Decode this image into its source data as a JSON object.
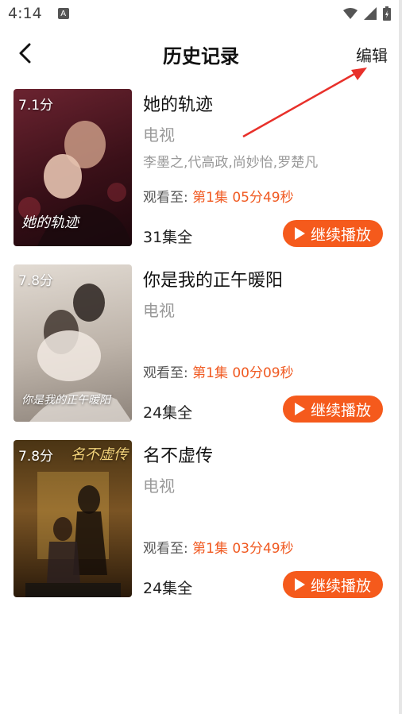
{
  "status_bar": {
    "time": "4:14",
    "app_badge": "A"
  },
  "header": {
    "title": "历史记录",
    "edit_label": "编辑"
  },
  "items": [
    {
      "score": "7.1分",
      "poster_title": "她的轨迹",
      "name": "她的轨迹",
      "type": "电视",
      "cast": "李墨之,代高政,尚妙怡,罗楚凡",
      "progress_label": "观看至:",
      "progress_value": "第1集 05分49秒",
      "episodes": "31集全",
      "play_label": "继续播放",
      "poster_colors": [
        "#5b1a22",
        "#2a0b12"
      ]
    },
    {
      "score": "7.8分",
      "poster_title": "你是我的正午暖阳",
      "name": "你是我的正午暖阳",
      "type": "电视",
      "cast": "",
      "progress_label": "观看至:",
      "progress_value": "第1集 00分09秒",
      "episodes": "24集全",
      "play_label": "继续播放",
      "poster_colors": [
        "#cfc6bd",
        "#8e847b"
      ]
    },
    {
      "score": "7.8分",
      "poster_title": "名不虚传",
      "name": "名不虚传",
      "type": "电视",
      "cast": "",
      "progress_label": "观看至:",
      "progress_value": "第1集 03分49秒",
      "episodes": "24集全",
      "play_label": "继续播放",
      "poster_colors": [
        "#6a4a1e",
        "#1e140a"
      ]
    }
  ]
}
